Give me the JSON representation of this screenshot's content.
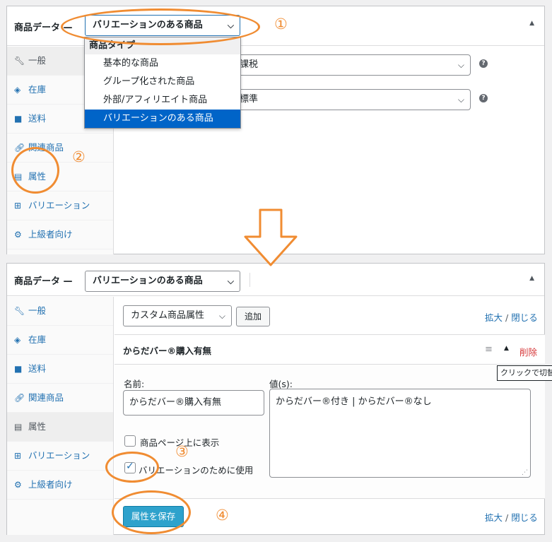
{
  "annotations": [
    "①",
    "②",
    "③",
    "④"
  ],
  "top_panel": {
    "title": "商品データ —",
    "product_type_value": "バリエーションのある商品",
    "dropdown": {
      "group_label": "商品タイプ",
      "options": [
        "基本的な商品",
        "グループ化された商品",
        "外部/アフィリエイト商品",
        "バリエーションのある商品"
      ]
    },
    "tax_status_value": "課税",
    "tax_class_value": "標準",
    "help_glyph": "?",
    "tabs": [
      "一般",
      "在庫",
      "送料",
      "関連商品",
      "属性",
      "バリエーション",
      "上級者向け"
    ]
  },
  "bottom_panel": {
    "title": "商品データ —",
    "product_type_value": "バリエーションのある商品",
    "tabs": [
      "一般",
      "在庫",
      "送料",
      "関連商品",
      "属性",
      "バリエーション",
      "上級者向け"
    ],
    "attribute_select_value": "カスタム商品属性",
    "add_button": "追加",
    "expand_label": "拡大",
    "collapse_label": "閉じる",
    "link_separator": "/",
    "attribute": {
      "title": "からだバー®購入有無",
      "delete_label": "削除",
      "tooltip": "クリックで切替",
      "name_label": "名前:",
      "name_value": "からだバー®購入有無",
      "values_label": "値(s):",
      "values_value": "からだバー®付き | からだバー®なし",
      "visible_label": "商品ページ上に表示",
      "variation_label": "バリエーションのために使用",
      "visible_checked": false,
      "variation_checked": true
    },
    "save_button": "属性を保存"
  },
  "colors": {
    "annotation": "#f08c32",
    "link": "#2271b1",
    "delete": "#d63638",
    "primary_button": "#2ea2cc",
    "selected_option": "#0064c8"
  },
  "icons": {
    "general": "wrench-icon",
    "inventory": "tag-icon",
    "shipping": "truck-icon",
    "linked": "link-icon",
    "attributes": "list-icon",
    "variations": "grid-icon",
    "advanced": "gear-icon"
  }
}
